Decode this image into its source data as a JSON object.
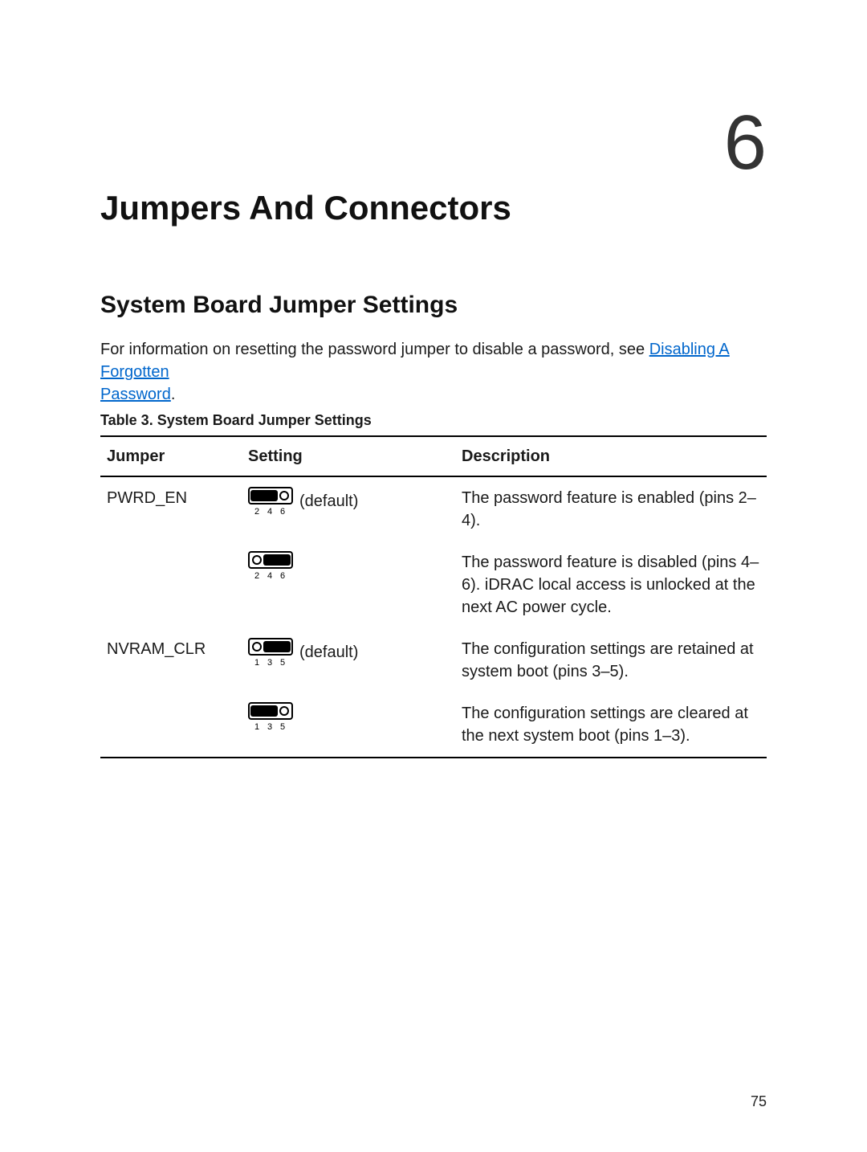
{
  "chapter": {
    "number": "6",
    "title": "Jumpers And Connectors"
  },
  "section": {
    "title": "System Board Jumper Settings"
  },
  "intro": {
    "prefix": "For information on resetting the password jumper to disable a password, see ",
    "link_part1": "Disabling A Forgotten",
    "link_part2": "Password",
    "suffix": "."
  },
  "table": {
    "caption": "Table 3. System Board Jumper Settings",
    "headers": {
      "jumper": "Jumper",
      "setting": "Setting",
      "description": "Description"
    },
    "rows": [
      {
        "jumper": "PWRD_EN",
        "setting_suffix": "(default)",
        "pin_labels": [
          "2",
          "4",
          "6"
        ],
        "description": "The password feature is enabled (pins 2–4)."
      },
      {
        "jumper": "",
        "setting_suffix": "",
        "pin_labels": [
          "2",
          "4",
          "6"
        ],
        "description": "The password feature is disabled (pins 4–6). iDRAC local access is unlocked at the next AC power cycle."
      },
      {
        "jumper": "NVRAM_CLR",
        "setting_suffix": "(default)",
        "pin_labels": [
          "1",
          "3",
          "5"
        ],
        "description": "The configuration settings are retained at system boot (pins 3–5)."
      },
      {
        "jumper": "",
        "setting_suffix": "",
        "pin_labels": [
          "1",
          "3",
          "5"
        ],
        "description": "The configuration settings are cleared at the next system boot (pins 1–3)."
      }
    ]
  },
  "page_number": "75"
}
